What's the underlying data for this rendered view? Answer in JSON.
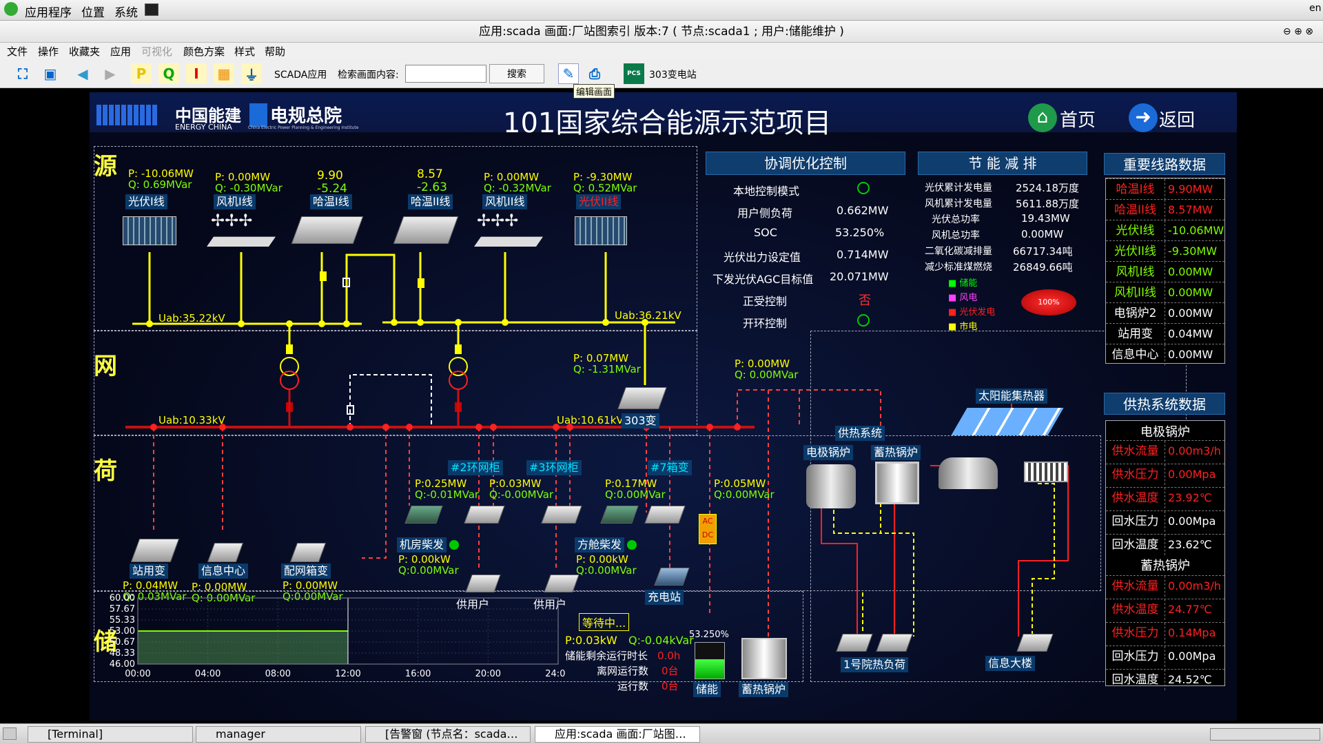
{
  "sysbar": {
    "apps": "应用程序",
    "places": "位置",
    "system": "系统",
    "lang": "en"
  },
  "window_title": "应用:scada  画面:厂站图索引  版本:7 ( 节点:scada1 ; 用户:储能维护 )",
  "menu": [
    "文件",
    "操作",
    "收藏夹",
    "应用",
    "可视化",
    "颜色方案",
    "样式",
    "帮助"
  ],
  "toolbar": {
    "scada_app": "SCADA应用",
    "search_label": "检索画面内容:",
    "search_value": "",
    "search_btn": "搜索",
    "tooltip": "编辑画面",
    "station": "303变电站"
  },
  "header": {
    "logo1_cn": "中国能建",
    "logo1_en": "ENERGY CHINA",
    "logo2_cn": "电规总院",
    "logo2_en": "China Electric Power Planning & Engineering Institute",
    "title": "101国家综合能源示范项目",
    "home": "首页",
    "back": "返回"
  },
  "sections": {
    "source": "源",
    "grid": "网",
    "load": "荷",
    "storage": "储"
  },
  "source": {
    "pv1": {
      "name": "光伏I线",
      "p": "P: -10.06MW",
      "q": "Q:  0.69MVar"
    },
    "wind1": {
      "name": "风机I线",
      "p": "P:  0.00MW",
      "q": "Q:  -0.30MVar"
    },
    "ha1": {
      "name": "哈温I线",
      "v1": "9.90",
      "v2": "-5.24"
    },
    "ha2": {
      "name": "哈温II线",
      "v1": "8.57",
      "v2": "-2.63"
    },
    "wind2": {
      "name": "风机II线",
      "p": "P:  0.00MW",
      "q": "Q:  -0.32MVar"
    },
    "pv2": {
      "name": "光伏II线",
      "p": "P:  -9.30MW",
      "q": "Q:  0.52MVar"
    },
    "uab1": "Uab:35.22kV",
    "uab2": "Uab:36.21kV"
  },
  "grid": {
    "uab3": "Uab:10.33kV",
    "uab4": "Uab:10.61kV",
    "bus303": "303变",
    "p303": "P:  0.07MW",
    "q303": "Q:  -1.31MVar",
    "pd": "P:   0.00MW",
    "qd": "Q:   0.00MVar"
  },
  "coord": {
    "title": "协调优化控制",
    "rows": [
      {
        "k": "本地控制模式",
        "v": ""
      },
      {
        "k": "用户侧负荷",
        "v": "0.662MW"
      },
      {
        "k": "SOC",
        "v": "53.250%"
      },
      {
        "k": "光伏出力设定值",
        "v": "0.714MW"
      },
      {
        "k": "下发光伏AGC目标值",
        "v": "20.071MW"
      },
      {
        "k": "正受控制",
        "v": "否"
      },
      {
        "k": "开环控制",
        "v": ""
      }
    ]
  },
  "energy": {
    "title": "节 能 减 排",
    "rows": [
      {
        "k": "光伏累计发电量",
        "v": "2524.18万度"
      },
      {
        "k": "风机累计发电量",
        "v": "5611.88万度"
      },
      {
        "k": "光伏总功率",
        "v": "19.43MW"
      },
      {
        "k": "风机总功率",
        "v": "0.00MW"
      },
      {
        "k": "二氧化碳减排量",
        "v": "66717.34吨"
      },
      {
        "k": "减少标准煤燃烧",
        "v": "26849.66吨"
      }
    ],
    "legend": [
      "储能",
      "风电",
      "光伏发电",
      "市电"
    ],
    "legend_colors": [
      "#00ff00",
      "#ff40ff",
      "#ff2020",
      "#ffff00"
    ],
    "pie": "100%"
  },
  "lines": {
    "title": "重要线路数据",
    "rows": [
      {
        "k": "哈温I线",
        "v": "9.90MW",
        "c": "#ff2020"
      },
      {
        "k": "哈温II线",
        "v": "8.57MW",
        "c": "#ff2020"
      },
      {
        "k": "光伏I线",
        "v": "-10.06MW",
        "c": "#7fff00"
      },
      {
        "k": "光伏II线",
        "v": "-9.30MW",
        "c": "#7fff00"
      },
      {
        "k": "风机I线",
        "v": "0.00MW",
        "c": "#7fff00"
      },
      {
        "k": "风机II线",
        "v": "0.00MW",
        "c": "#7fff00"
      },
      {
        "k": "电锅炉2",
        "v": "0.00MW",
        "c": "#ffffff"
      },
      {
        "k": "站用变",
        "v": "0.04MW",
        "c": "#ffffff"
      },
      {
        "k": "信息中心",
        "v": "0.00MW",
        "c": "#ffffff"
      }
    ]
  },
  "heat": {
    "title": "供热系统数据",
    "boiler1": "电极锅炉",
    "boiler2": "蓄热锅炉",
    "rows1": [
      {
        "k": "供水流量",
        "v": "0.00m3/h",
        "c": "#ff2020"
      },
      {
        "k": "供水压力",
        "v": "0.00Mpa",
        "c": "#ff2020"
      },
      {
        "k": "供水温度",
        "v": "23.92℃",
        "c": "#ff2020"
      },
      {
        "k": "回水压力",
        "v": "0.00Mpa",
        "c": "#ffffff"
      },
      {
        "k": "回水温度",
        "v": "23.62℃",
        "c": "#ffffff"
      }
    ],
    "rows2": [
      {
        "k": "供水流量",
        "v": "0.00m3/h",
        "c": "#ff2020"
      },
      {
        "k": "供水温度",
        "v": "24.77℃",
        "c": "#ff2020"
      },
      {
        "k": "供水压力",
        "v": "0.14Mpa",
        "c": "#ff2020"
      },
      {
        "k": "回水压力",
        "v": "0.00Mpa",
        "c": "#ffffff"
      },
      {
        "k": "回水温度",
        "v": "24.52℃",
        "c": "#ffffff"
      }
    ]
  },
  "heatsys": {
    "label": "供热系统",
    "elec": "电极锅炉",
    "store": "蓄热锅炉",
    "solar": "太阳能集热器",
    "load1": "1号院热负荷",
    "info": "信息大楼"
  },
  "load": {
    "ring2": "#2环网柜",
    "ring3": "#3环网柜",
    "box7": "#7箱变",
    "p_ring2": "P:0.25MW",
    "q_ring2": "Q:-0.01MVar",
    "p_ring3": "P:0.03MW",
    "q_ring3": "Q:-0.00MVar",
    "p_box7": "P:0.17MW",
    "q_box7": "Q:0.00MVar",
    "p_ac": "P:0.05MW",
    "q_ac": "Q:0.00MVar",
    "zyb": "站用变",
    "zyb_p": "P:  0.04MW",
    "zyb_q": "Q:  0.03MVar",
    "xx": "信息中心",
    "xx_p": "P:  0.00MW",
    "xx_q": "Q:  0.00MVar",
    "pw": "配网箱变",
    "pw_p": "P: 0.00MW",
    "pw_q": "Q:0.00MVar",
    "jf": "机房柴发",
    "jf_p": "P: 0.00kW",
    "jf_q": "Q:0.00MVar",
    "fc": "方舱柴发",
    "fc_p": "P: 0.00kW",
    "fc_q": "Q:0.00MVar",
    "user1": "供用户",
    "user2": "供用户",
    "charge": "充电站",
    "ac": "AC",
    "dc": "DC"
  },
  "storage": {
    "status": "等待中...",
    "p": "P:0.03kW",
    "q": "Q:-0.04kVar",
    "remain_lbl": "储能剩余运行时长",
    "remain": "0.0h",
    "off_lbl": "离网运行数",
    "off": "0台",
    "run_lbl": "运行数",
    "run": "0台",
    "soc": "53.250%",
    "bat": "储能",
    "heat_store": "蓄热锅炉"
  },
  "chart_data": {
    "type": "area",
    "x": [
      "00:00",
      "04:00",
      "08:00",
      "12:00"
    ],
    "y": [
      53.0,
      53.0,
      53.0,
      53.0
    ],
    "yticks": [
      "60.00",
      "57.67",
      "55.33",
      "53.00",
      "50.67",
      "48.33",
      "46.00"
    ],
    "xticks": [
      "00:00",
      "04:00",
      "08:00",
      "12:00",
      "16:00",
      "20:00",
      "24:00"
    ],
    "ylim": [
      46,
      60
    ]
  },
  "taskbar": [
    "[Terminal]",
    "manager",
    "[告警窗 (节点名：scada…",
    "应用:scada  画面:厂站图…"
  ]
}
